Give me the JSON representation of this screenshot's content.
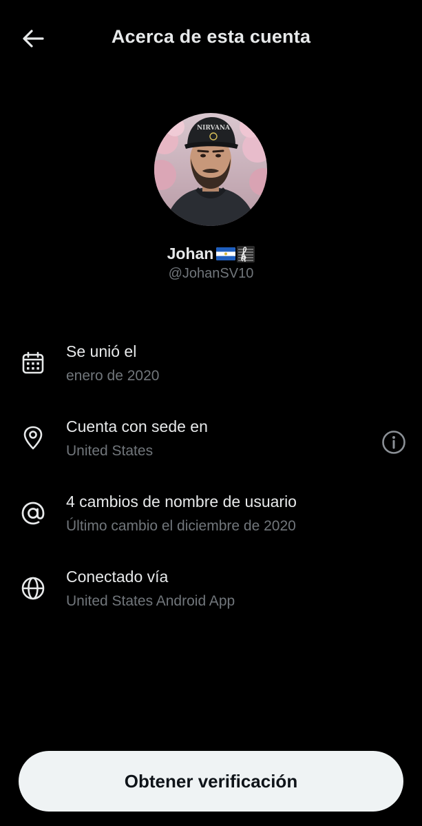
{
  "header": {
    "title": "Acerca de esta cuenta"
  },
  "profile": {
    "display_name": "Johan",
    "handle": "@JohanSV10",
    "avatar_cap_text": "NIRVANA"
  },
  "rows": [
    {
      "icon": "calendar-icon",
      "title": "Se unió el",
      "subtitle": "enero de 2020"
    },
    {
      "icon": "location-pin-icon",
      "title": "Cuenta con sede en",
      "subtitle": "United States"
    },
    {
      "icon": "at-sign-icon",
      "title": "4 cambios de nombre de usuario",
      "subtitle": "Último cambio el diciembre de 2020"
    },
    {
      "icon": "globe-icon",
      "title": "Conectado vía",
      "subtitle": "United States Android App"
    }
  ],
  "cta": {
    "label": "Obtener verificación"
  },
  "colors": {
    "background": "#000000",
    "primary_text": "#e7e9ea",
    "secondary_text": "#71767b",
    "button_bg": "#eff3f4",
    "button_text": "#0f1419"
  }
}
